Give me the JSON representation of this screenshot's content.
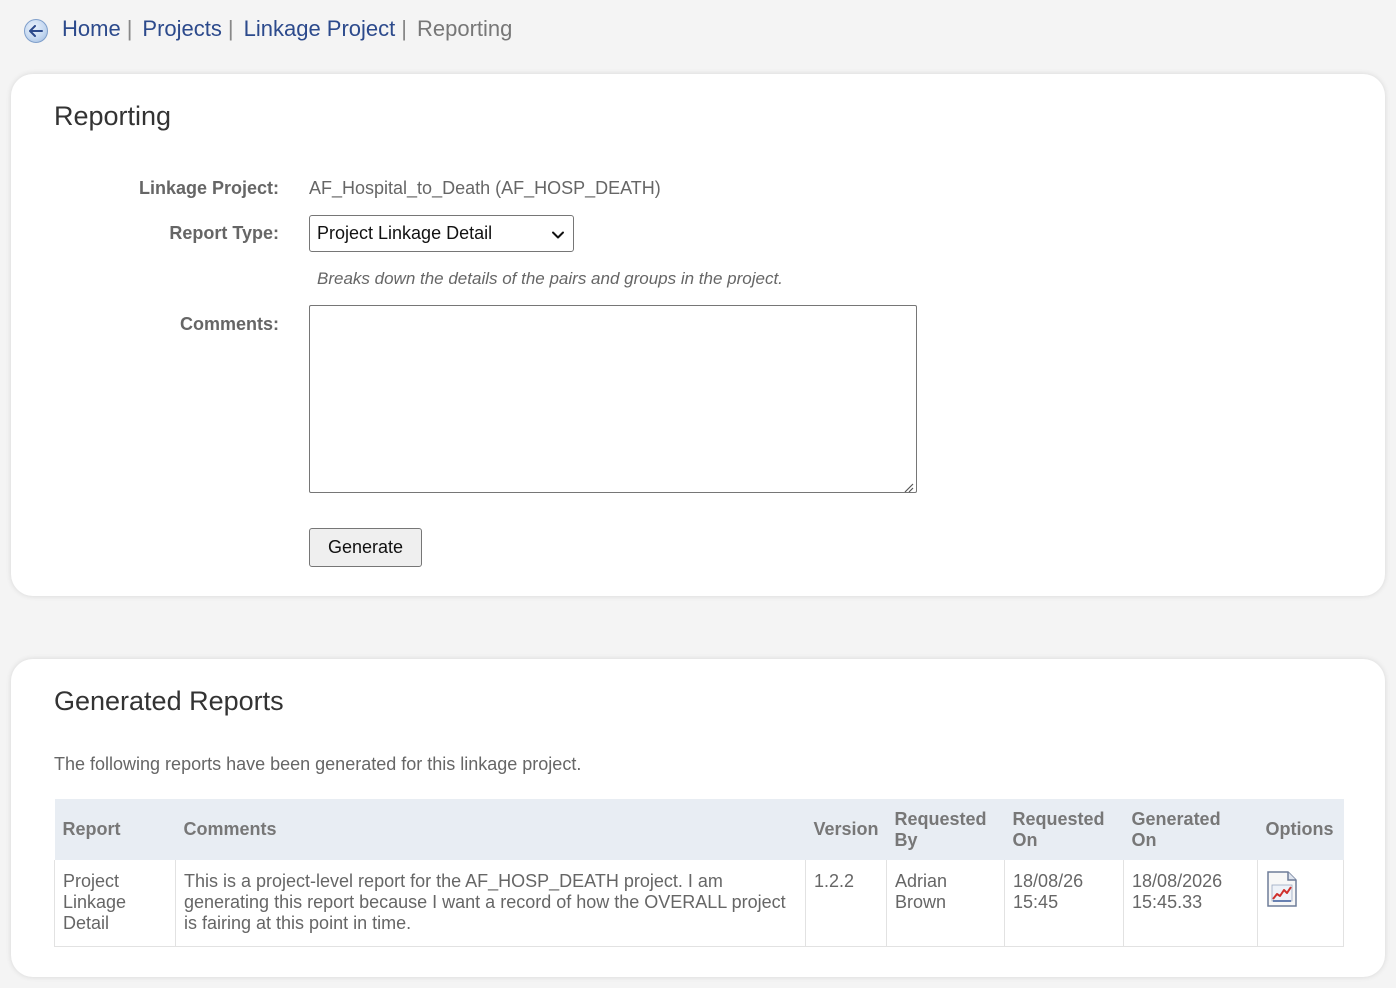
{
  "breadcrumb": {
    "back_icon": "back-arrow-icon",
    "home": "Home",
    "projects": "Projects",
    "linkage_project": "Linkage Project",
    "current": "Reporting",
    "separator": "|"
  },
  "reporting": {
    "title": "Reporting",
    "linkage_project_label": "Linkage Project:",
    "linkage_project_value": "AF_Hospital_to_Death (AF_HOSP_DEATH)",
    "report_type_label": "Report Type:",
    "report_type_selected": "Project Linkage Detail",
    "report_type_hint": "Breaks down the details of the pairs and groups in the project.",
    "comments_label": "Comments:",
    "comments_value": "",
    "generate_label": "Generate"
  },
  "generated": {
    "title": "Generated Reports",
    "intro": "The following reports have been generated for this linkage project.",
    "columns": {
      "report": "Report",
      "comments": "Comments",
      "version": "Version",
      "requested_by": "Requested By",
      "requested_on": "Requested On",
      "generated_on": "Generated On",
      "options": "Options"
    },
    "rows": [
      {
        "report": "Project Linkage Detail",
        "comments": "This is a project-level report for the AF_HOSP_DEATH project. I am generating this report because I want a record of how the OVERALL project is fairing at this point in time.",
        "version": "1.2.2",
        "requested_by": "Adrian Brown",
        "requested_on": "18/08/26 15:45",
        "generated_on": "18/08/2026 15:45.33",
        "option_icon": "report-chart-icon"
      }
    ]
  }
}
